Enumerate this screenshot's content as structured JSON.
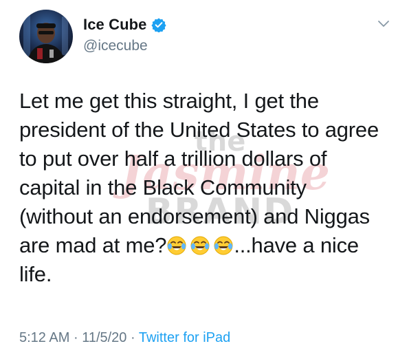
{
  "author": {
    "display_name": "Ice Cube",
    "handle": "@icecube",
    "verified": true,
    "avatar_icon": "profile-photo"
  },
  "tweet": {
    "line1": "Let me get this straight, I get the",
    "line2": "president of the United States to agree",
    "line3": "to put over half a trillion dollars of",
    "line4": "capital in the Black Community",
    "line5": "(without an endorsement) and Niggas",
    "line6_before": "are mad at me?",
    "emojis": [
      "face-with-tears-of-joy",
      "face-with-tears-of-joy",
      "face-with-tears-of-joy"
    ],
    "line6_after": "...have a nice",
    "line7": "life."
  },
  "meta": {
    "time": "5:12 AM",
    "separator": "·",
    "date": "11/5/20",
    "source": "Twitter for iPad"
  },
  "watermark": {
    "line1": "the",
    "line2": "Jasmine",
    "line3": "BRAND"
  },
  "colors": {
    "text": "#14171a",
    "secondary": "#657786",
    "accent": "#1da1f2",
    "verified_badge": "#1da1f2"
  },
  "icons": {
    "more_menu": "chevron-down-icon",
    "verified": "verified-badge-icon"
  }
}
